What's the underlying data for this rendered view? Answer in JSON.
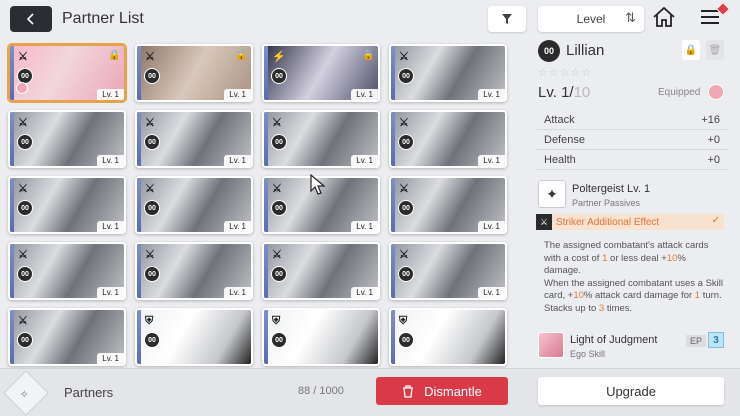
{
  "header": {
    "title": "Partner List",
    "sort_label": "Level"
  },
  "cards": [
    {
      "grade": "00",
      "level": "Lv. 1",
      "locked": true,
      "selected": true,
      "art": "pink",
      "role": "striker",
      "equip": true
    },
    {
      "grade": "00",
      "level": "Lv. 1",
      "locked": true,
      "selected": false,
      "art": "brown",
      "role": "striker",
      "equip": false
    },
    {
      "grade": "00",
      "level": "Lv. 1",
      "locked": true,
      "selected": false,
      "art": "dark",
      "role": "lightning",
      "equip": false
    },
    {
      "grade": "00",
      "level": "Lv. 1",
      "locked": false,
      "selected": false,
      "art": "grey",
      "role": "striker",
      "equip": false
    },
    {
      "grade": "00",
      "level": "Lv. 1",
      "locked": false,
      "selected": false,
      "art": "grey",
      "role": "striker",
      "equip": false
    },
    {
      "grade": "00",
      "level": "Lv. 1",
      "locked": false,
      "selected": false,
      "art": "grey",
      "role": "striker",
      "equip": false
    },
    {
      "grade": "00",
      "level": "Lv. 1",
      "locked": false,
      "selected": false,
      "art": "grey",
      "role": "striker",
      "equip": false
    },
    {
      "grade": "00",
      "level": "Lv. 1",
      "locked": false,
      "selected": false,
      "art": "grey",
      "role": "striker",
      "equip": false
    },
    {
      "grade": "00",
      "level": "Lv. 1",
      "locked": false,
      "selected": false,
      "art": "grey",
      "role": "striker",
      "equip": false
    },
    {
      "grade": "00",
      "level": "Lv. 1",
      "locked": false,
      "selected": false,
      "art": "grey",
      "role": "striker",
      "equip": false
    },
    {
      "grade": "00",
      "level": "Lv. 1",
      "locked": false,
      "selected": false,
      "art": "grey",
      "role": "striker",
      "equip": false
    },
    {
      "grade": "00",
      "level": "Lv. 1",
      "locked": false,
      "selected": false,
      "art": "grey",
      "role": "striker",
      "equip": false
    },
    {
      "grade": "00",
      "level": "Lv. 1",
      "locked": false,
      "selected": false,
      "art": "grey",
      "role": "striker",
      "equip": false
    },
    {
      "grade": "00",
      "level": "Lv. 1",
      "locked": false,
      "selected": false,
      "art": "grey",
      "role": "striker",
      "equip": false
    },
    {
      "grade": "00",
      "level": "Lv. 1",
      "locked": false,
      "selected": false,
      "art": "grey",
      "role": "striker",
      "equip": false
    },
    {
      "grade": "00",
      "level": "Lv. 1",
      "locked": false,
      "selected": false,
      "art": "grey",
      "role": "striker",
      "equip": false
    },
    {
      "grade": "00",
      "level": "Lv. 1",
      "locked": false,
      "selected": false,
      "art": "grey",
      "role": "striker",
      "equip": false
    },
    {
      "grade": "00",
      "level": "",
      "locked": false,
      "selected": false,
      "art": "white",
      "role": "shield",
      "equip": false
    },
    {
      "grade": "00",
      "level": "",
      "locked": false,
      "selected": false,
      "art": "white",
      "role": "shield",
      "equip": false
    },
    {
      "grade": "00",
      "level": "",
      "locked": false,
      "selected": false,
      "art": "white",
      "role": "shield",
      "equip": false
    }
  ],
  "detail": {
    "grade": "00",
    "name": "Lillian",
    "stars": "☆☆☆☆☆",
    "level_current": "Lv. 1/",
    "level_max": "10",
    "equipped_label": "Equipped",
    "stats": [
      {
        "label": "Attack",
        "value": "+16"
      },
      {
        "label": "Defense",
        "value": "+0"
      },
      {
        "label": "Health",
        "value": "+0"
      }
    ],
    "passive": {
      "title": "Poltergeist Lv. 1",
      "subtitle": "Partner Passives",
      "effect_label": "Striker Additional Effect",
      "desc_parts": [
        "The assigned combatant's attack cards with a cost of ",
        "1",
        " or less deal +",
        "10",
        "% damage.",
        "When the assigned combatant uses a Skill card, +",
        "10",
        "% attack card damage for ",
        "1",
        " turn. Stacks up to ",
        "3",
        " times."
      ]
    },
    "ego": {
      "title": "Light of Judgment",
      "subtitle": "Ego Skill",
      "ep_label": "EP",
      "ep_value": "3"
    }
  },
  "footer": {
    "partners_label": "Partners",
    "count": "88 / 1000",
    "dismantle_label": "Dismantle",
    "upgrade_label": "Upgrade"
  },
  "colors": {
    "accent_red": "#d93a48",
    "highlight_orange": "#e07a3a",
    "selected_border": "#e8a24c"
  }
}
